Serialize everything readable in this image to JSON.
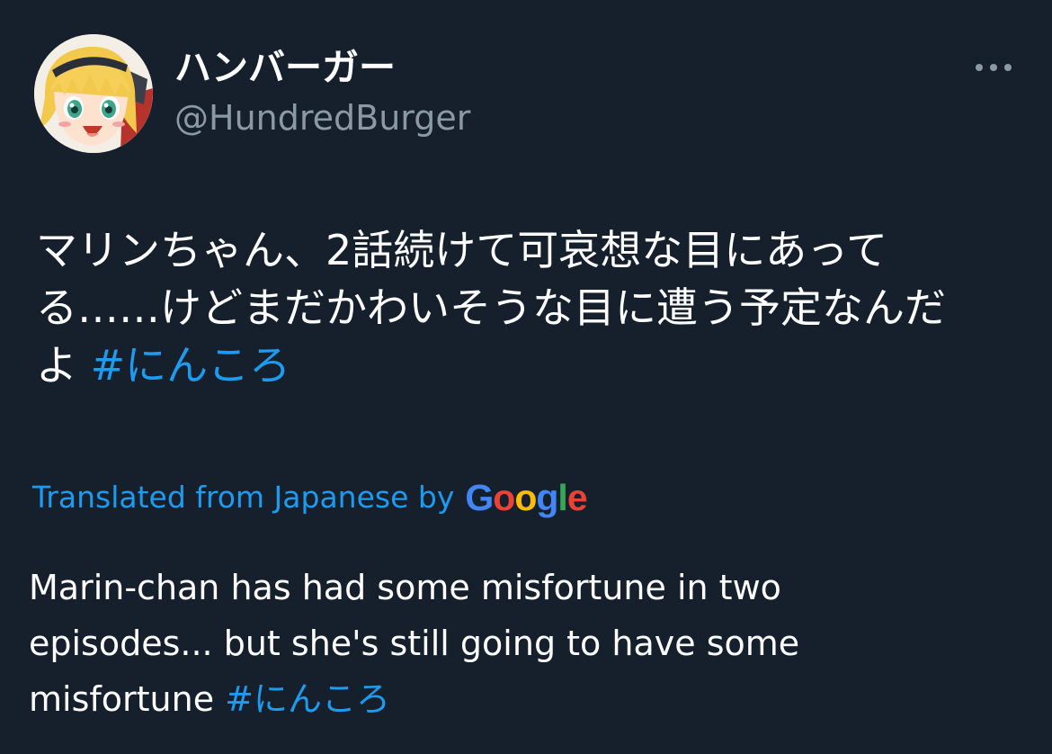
{
  "author": {
    "display_name": "ハンバーガー",
    "handle": "@HundredBurger"
  },
  "icons": {
    "more": "more-horizontal-icon",
    "avatar": "anime-girl-avatar"
  },
  "tweet": {
    "lines": [
      "マリンちゃん、2話続けて可哀想な目にあって",
      "る……けどまだかわいそうな目に遭う予定なんだ",
      "よ"
    ],
    "hashtag": "#にんころ"
  },
  "translation": {
    "label": "Translated from Japanese by",
    "provider": "Google",
    "lines": [
      "Marin-chan has had some misfortune in two",
      "episodes... but she's still going to have some",
      "misfortune"
    ],
    "hashtag": "#にんころ"
  },
  "colors": {
    "background": "#16202c",
    "text": "#ffffff",
    "secondary_text": "#8b98a5",
    "link": "#1d9bf0"
  }
}
